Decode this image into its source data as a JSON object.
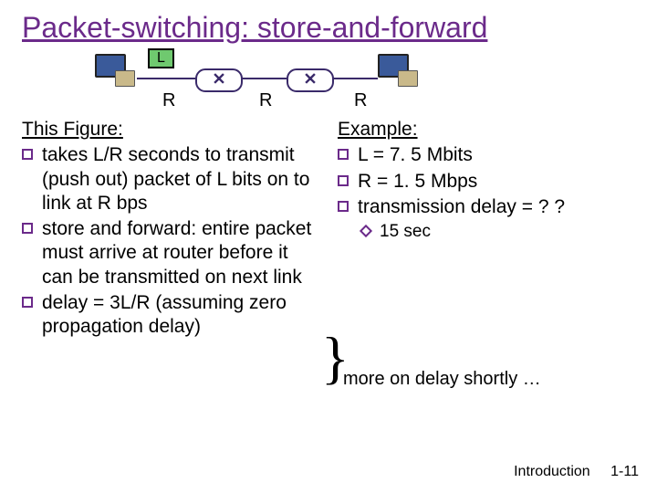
{
  "title": "Packet-switching: store-and-forward",
  "diagram": {
    "packet_label": "L",
    "link_labels": [
      "R",
      "R",
      "R"
    ]
  },
  "left": {
    "heading": "This Figure:",
    "items": [
      "takes L/R seconds to transmit (push out) packet of L bits on to link at R bps",
      "store and forward: entire packet must arrive at router before it can be transmitted on next link",
      "delay = 3L/R (assuming zero propagation delay)"
    ]
  },
  "right": {
    "heading": "Example:",
    "items": [
      "L = 7. 5 Mbits",
      "R = 1. 5 Mbps",
      "transmission delay = ? ?"
    ],
    "subitems": [
      "15 sec"
    ]
  },
  "more_text": "more on delay shortly …",
  "footer": {
    "section": "Introduction",
    "page": "1-11"
  }
}
